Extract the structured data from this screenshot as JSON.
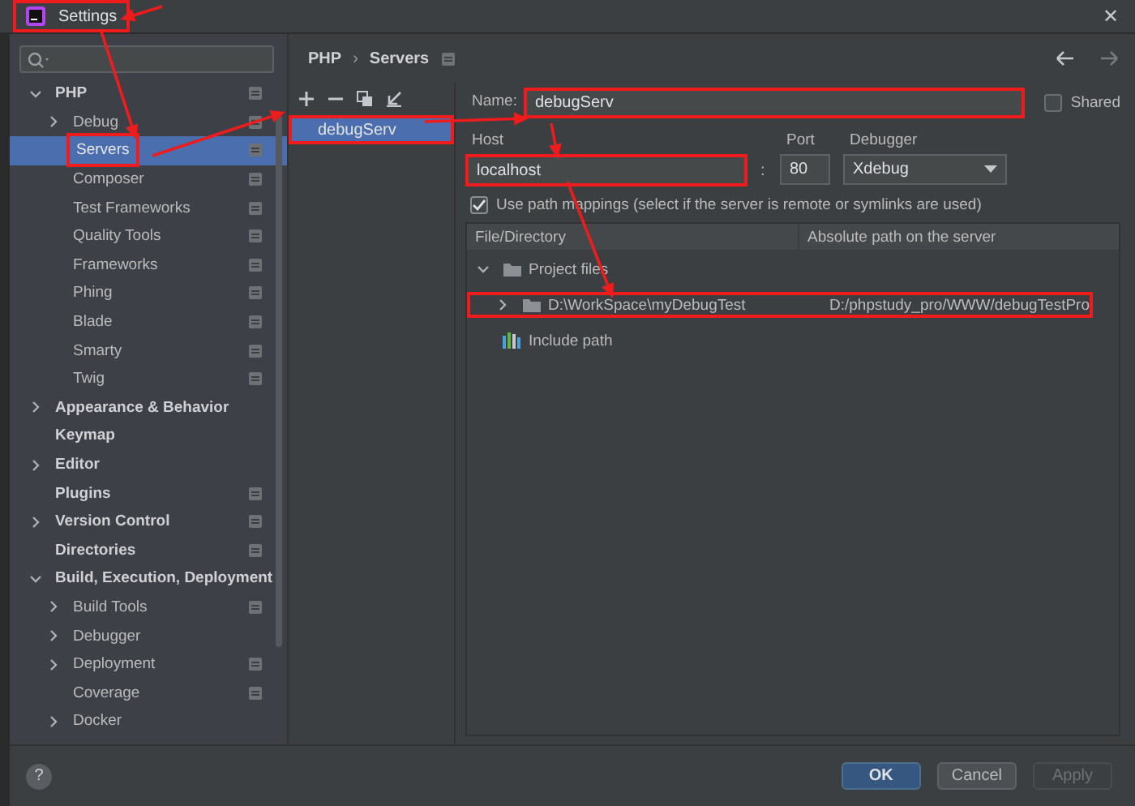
{
  "window": {
    "title": "Settings",
    "highlighted": true,
    "close": "✕"
  },
  "sidebar": {
    "items": [
      {
        "label": "PHP",
        "kind": "group",
        "expanded": true,
        "project_level": true,
        "selected": false,
        "highlighted": false,
        "children": [
          {
            "label": "Debug",
            "kind": "group",
            "expanded": false,
            "project_level": true,
            "selected": false,
            "highlighted": false
          },
          {
            "label": "Servers",
            "kind": "leaf",
            "project_level": true,
            "selected": true,
            "highlighted": true
          },
          {
            "label": "Composer",
            "kind": "leaf",
            "project_level": true,
            "selected": false,
            "highlighted": false
          },
          {
            "label": "Test Frameworks",
            "kind": "leaf",
            "project_level": true,
            "selected": false,
            "highlighted": false
          },
          {
            "label": "Quality Tools",
            "kind": "leaf",
            "project_level": true,
            "selected": false,
            "highlighted": false
          },
          {
            "label": "Frameworks",
            "kind": "leaf",
            "project_level": true,
            "selected": false,
            "highlighted": false
          },
          {
            "label": "Phing",
            "kind": "leaf",
            "project_level": true,
            "selected": false,
            "highlighted": false
          },
          {
            "label": "Blade",
            "kind": "leaf",
            "project_level": true,
            "selected": false,
            "highlighted": false
          },
          {
            "label": "Smarty",
            "kind": "leaf",
            "project_level": true,
            "selected": false,
            "highlighted": false
          },
          {
            "label": "Twig",
            "kind": "leaf",
            "project_level": true,
            "selected": false,
            "highlighted": false
          }
        ]
      },
      {
        "label": "Appearance & Behavior",
        "kind": "group",
        "expanded": false,
        "project_level": false,
        "selected": false,
        "highlighted": false
      },
      {
        "label": "Keymap",
        "kind": "leaf",
        "project_level": false,
        "selected": false,
        "highlighted": false
      },
      {
        "label": "Editor",
        "kind": "group",
        "expanded": false,
        "project_level": false,
        "selected": false,
        "highlighted": false
      },
      {
        "label": "Plugins",
        "kind": "leaf",
        "project_level": true,
        "selected": false,
        "highlighted": false
      },
      {
        "label": "Version Control",
        "kind": "group",
        "expanded": false,
        "project_level": true,
        "selected": false,
        "highlighted": false
      },
      {
        "label": "Directories",
        "kind": "leaf",
        "project_level": true,
        "selected": false,
        "highlighted": false
      },
      {
        "label": "Build, Execution, Deployment",
        "kind": "group",
        "expanded": true,
        "project_level": false,
        "selected": false,
        "highlighted": false,
        "children": [
          {
            "label": "Build Tools",
            "kind": "group",
            "expanded": false,
            "project_level": true,
            "selected": false,
            "highlighted": false
          },
          {
            "label": "Debugger",
            "kind": "group",
            "expanded": false,
            "project_level": false,
            "selected": false,
            "highlighted": false
          },
          {
            "label": "Deployment",
            "kind": "group",
            "expanded": false,
            "project_level": true,
            "selected": false,
            "highlighted": false
          },
          {
            "label": "Coverage",
            "kind": "leaf",
            "project_level": true,
            "selected": false,
            "highlighted": false
          },
          {
            "label": "Docker",
            "kind": "group",
            "expanded": false,
            "project_level": false,
            "selected": false,
            "highlighted": false
          }
        ]
      }
    ]
  },
  "breadcrumb": {
    "parts": [
      "PHP",
      "Servers"
    ],
    "separator": "›",
    "project_level": true
  },
  "servers": {
    "items": [
      {
        "label": "debugServ",
        "selected": true,
        "highlighted": true
      }
    ]
  },
  "form": {
    "name_label": "Name:",
    "name": {
      "value": "debugServ",
      "highlighted": true
    },
    "shared": {
      "label": "Shared",
      "checked": false
    },
    "host_label": "Host",
    "host": {
      "value": "localhost",
      "highlighted": true
    },
    "port_separator": ":",
    "port_label": "Port",
    "port": "80",
    "debugger_label": "Debugger",
    "debugger": "Xdebug",
    "path_mappings": {
      "label": "Use path mappings (select if the server is remote or symlinks are used)",
      "checked": true
    }
  },
  "mappings": {
    "columns": [
      "File/Directory",
      "Absolute path on the server"
    ],
    "rows": [
      {
        "label": "Project files",
        "kind": "folder",
        "expanded": true,
        "highlighted": false,
        "children": [
          {
            "label": "D:\\WorkSpace\\myDebugTest",
            "server_path": "D:/phpstudy_pro/WWW/debugTestPro",
            "kind": "folder",
            "expanded": false,
            "highlighted": true
          }
        ]
      },
      {
        "label": "Include path",
        "kind": "library",
        "highlighted": false
      }
    ]
  },
  "help": "?",
  "buttons": [
    {
      "label": "OK",
      "kind": "primary",
      "disabled": false
    },
    {
      "label": "Cancel",
      "kind": "normal",
      "disabled": false
    },
    {
      "label": "Apply",
      "kind": "normal",
      "disabled": true
    }
  ],
  "annotations": {
    "arrows": true
  }
}
